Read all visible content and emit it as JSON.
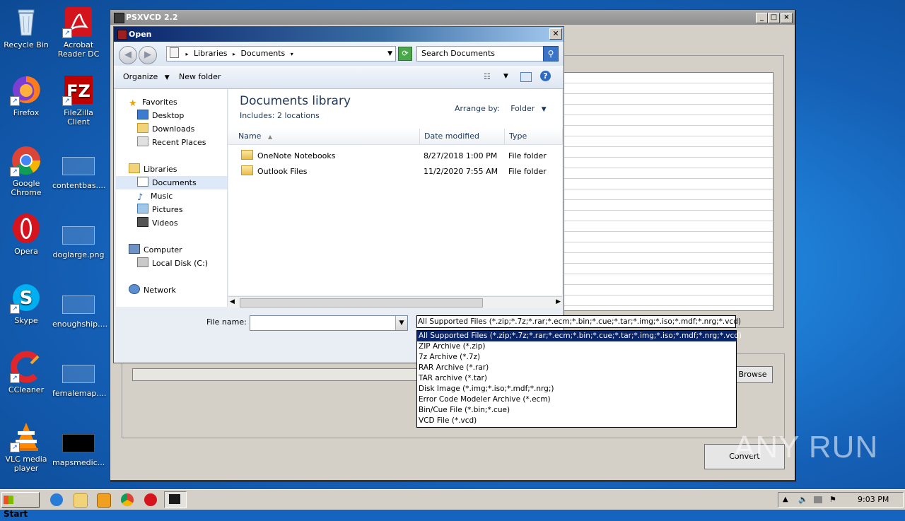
{
  "desktop_icons": [
    {
      "label": "Recycle Bin",
      "icon": "recycle-bin-icon"
    },
    {
      "label": "Acrobat Reader DC",
      "icon": "acrobat-icon"
    },
    {
      "label": "Firefox",
      "icon": "firefox-icon"
    },
    {
      "label": "FileZilla Client",
      "icon": "filezilla-icon"
    },
    {
      "label": "Google Chrome",
      "icon": "chrome-icon"
    },
    {
      "label": "contentbas....",
      "icon": "file-icon"
    },
    {
      "label": "Opera",
      "icon": "opera-icon"
    },
    {
      "label": "doglarge.png",
      "icon": "file-icon"
    },
    {
      "label": "Skype",
      "icon": "skype-icon"
    },
    {
      "label": "enoughship....",
      "icon": "file-icon"
    },
    {
      "label": "CCleaner",
      "icon": "ccleaner-icon"
    },
    {
      "label": "femalemap....",
      "icon": "file-icon"
    },
    {
      "label": "VLC media player",
      "icon": "vlc-icon"
    },
    {
      "label": "mapsmedic...",
      "icon": "file-icon"
    }
  ],
  "main_window": {
    "title": "PSXVCD 2.2",
    "browse_label": "Browse",
    "convert_label": "Convert"
  },
  "dialog": {
    "title": "Open",
    "breadcrumb": [
      "Libraries",
      "Documents"
    ],
    "search_placeholder": "Search Documents",
    "organize_label": "Organize",
    "new_folder_label": "New folder",
    "nav": {
      "favorites": "Favorites",
      "desktop": "Desktop",
      "downloads": "Downloads",
      "recent": "Recent Places",
      "libraries": "Libraries",
      "documents": "Documents",
      "music": "Music",
      "pictures": "Pictures",
      "videos": "Videos",
      "computer": "Computer",
      "local_disk": "Local Disk (C:)",
      "network": "Network"
    },
    "library_title": "Documents library",
    "library_sub": "Includes:  2 locations",
    "arrange_label": "Arrange by:",
    "arrange_value": "Folder",
    "columns": {
      "name": "Name",
      "date": "Date modified",
      "type": "Type"
    },
    "files": [
      {
        "name": "OneNote Notebooks",
        "date": "8/27/2018 1:00 PM",
        "type": "File folder"
      },
      {
        "name": "Outlook Files",
        "date": "11/2/2020 7:55 AM",
        "type": "File folder"
      }
    ],
    "filename_label": "File name:",
    "filename_value": "",
    "filetype_selected": "All Supported Files (*.zip;*.7z;*.rar;*.ecm;*.bin;*.cue;*.tar;*.img;*.iso;*.mdf;*.nrg;*.vcd)",
    "filetype_options": [
      "All Supported Files (*.zip;*.7z;*.rar;*.ecm;*.bin;*.cue;*.tar;*.img;*.iso;*.mdf;*.nrg;*.vcd)",
      "ZIP Archive (*.zip)",
      "7z Archive (*.7z)",
      "RAR Archive (*.rar)",
      "TAR archive (*.tar)",
      "Disk Image (*.img;*.iso;*.mdf;*.nrg;)",
      "Error Code Modeler Archive (*.ecm)",
      "Bin/Cue File (*.bin;*.cue)",
      "VCD File (*.vcd)"
    ]
  },
  "taskbar": {
    "start_label": "Start",
    "clock": "9:03 PM"
  },
  "watermark": "ANY RUN"
}
